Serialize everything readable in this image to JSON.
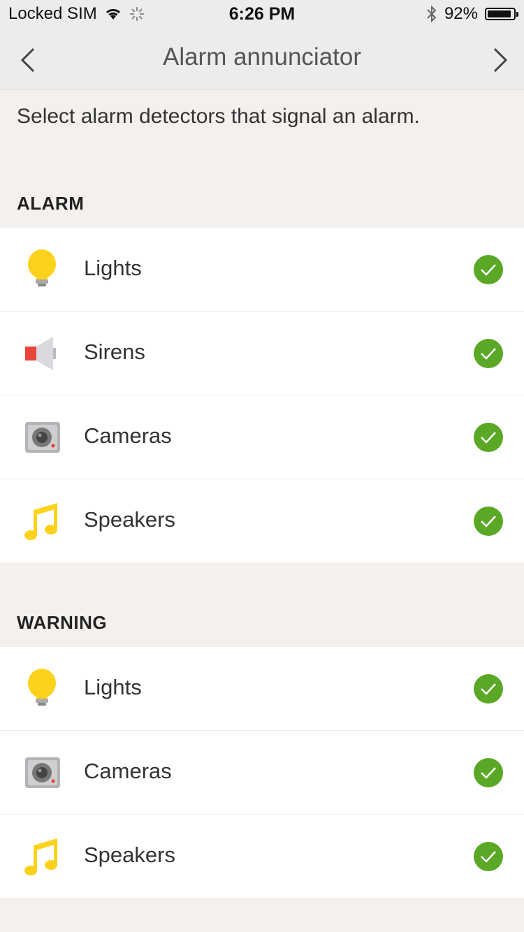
{
  "status": {
    "carrier": "Locked SIM",
    "time": "6:26 PM",
    "battery_percent": "92%",
    "battery_level": 0.92
  },
  "nav": {
    "title": "Alarm annunciator",
    "back_icon": "chevron-left-icon",
    "forward_icon": "chevron-right-icon"
  },
  "intro": "Select alarm detectors that signal an alarm.",
  "colors": {
    "check": "#5aa826",
    "background": "#f4f0ed"
  },
  "alarm": {
    "header": "ALARM",
    "items": [
      {
        "label": "Lights",
        "icon": "lightbulb-icon",
        "checked": true
      },
      {
        "label": "Sirens",
        "icon": "siren-icon",
        "checked": true
      },
      {
        "label": "Cameras",
        "icon": "camera-icon",
        "checked": true
      },
      {
        "label": "Speakers",
        "icon": "music-note-icon",
        "checked": true
      }
    ]
  },
  "warning": {
    "header": "WARNING",
    "items": [
      {
        "label": "Lights",
        "icon": "lightbulb-icon",
        "checked": true
      },
      {
        "label": "Cameras",
        "icon": "camera-icon",
        "checked": true
      },
      {
        "label": "Speakers",
        "icon": "music-note-icon",
        "checked": true
      }
    ]
  }
}
